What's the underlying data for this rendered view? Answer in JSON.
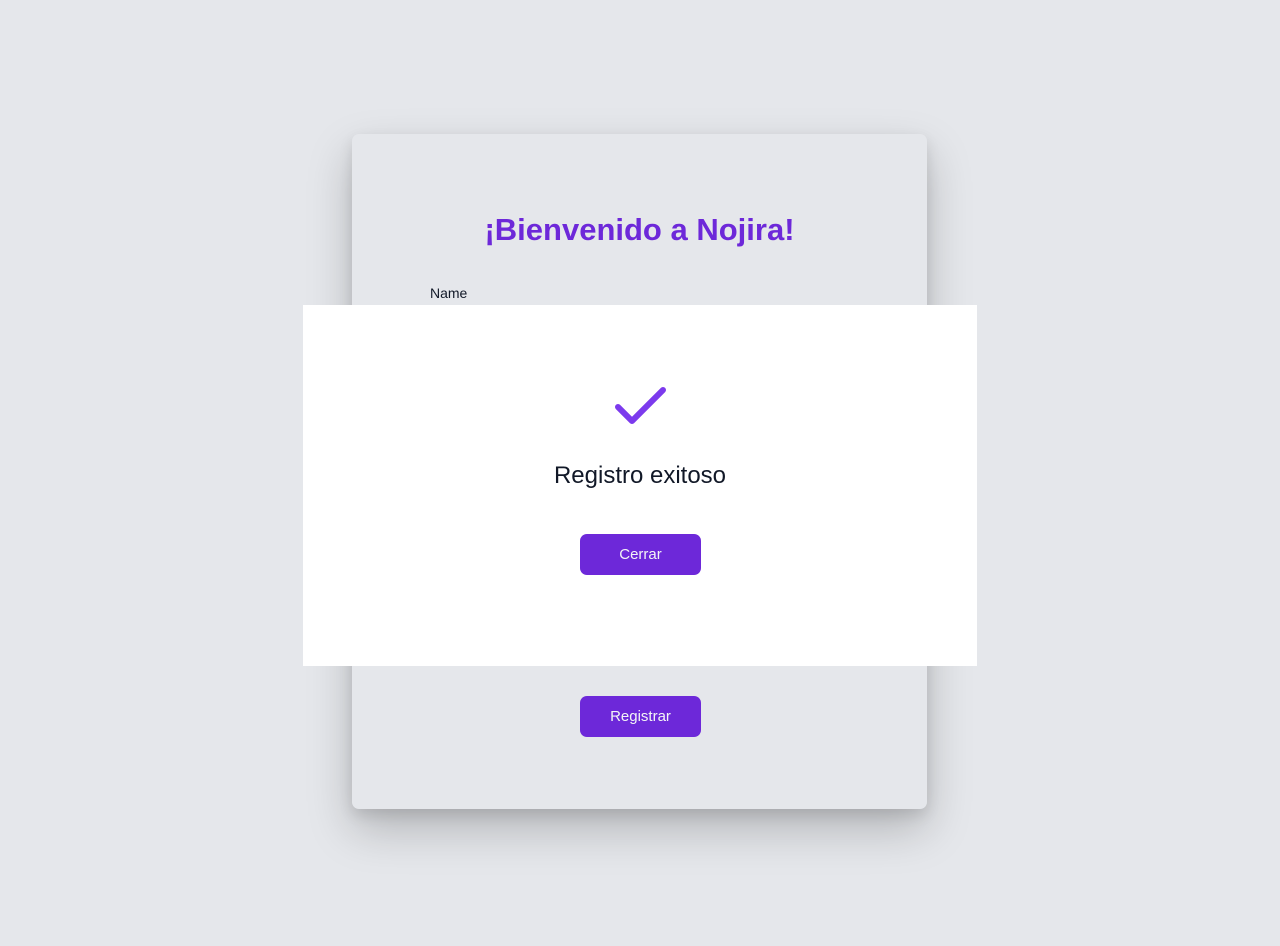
{
  "form": {
    "title": "¡Bienvenido a Nojira!",
    "name_label": "Name",
    "submit_label": "Registrar"
  },
  "modal": {
    "icon": "checkmark-icon",
    "message": "Registro exitoso",
    "close_label": "Cerrar"
  },
  "colors": {
    "accent": "#6d28d9",
    "check": "#7c3aed",
    "background": "#e5e7eb",
    "text": "#111827",
    "modal_bg": "#ffffff"
  }
}
